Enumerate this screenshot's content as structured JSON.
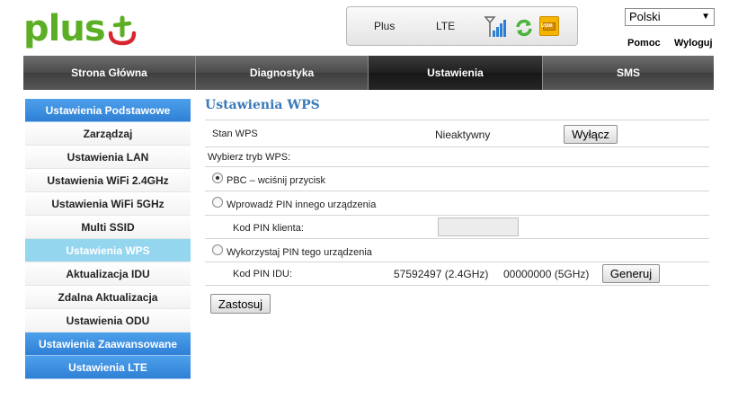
{
  "header": {
    "logo_text": "plus",
    "operator": "Plus",
    "network_type": "LTE",
    "sim_label": "USIM",
    "language_selected": "Polski",
    "help_label": "Pomoc",
    "logout_label": "Wyloguj"
  },
  "topnav": [
    {
      "label": "Strona Główna"
    },
    {
      "label": "Diagnostyka"
    },
    {
      "label": "Ustawienia"
    },
    {
      "label": "SMS"
    }
  ],
  "sidebar": {
    "items": [
      {
        "label": "Ustawienia Podstawowe"
      },
      {
        "label": "Zarządzaj"
      },
      {
        "label": "Ustawienia LAN"
      },
      {
        "label": "Ustawienia WiFi 2.4GHz"
      },
      {
        "label": "Ustawienia WiFi 5GHz"
      },
      {
        "label": "Multi SSID"
      },
      {
        "label": "Ustawienia WPS"
      },
      {
        "label": "Aktualizacja IDU"
      },
      {
        "label": "Zdalna Aktualizacja"
      },
      {
        "label": "Ustawienia ODU"
      },
      {
        "label": "Ustawienia Zaawansowane"
      },
      {
        "label": "Ustawienia LTE"
      }
    ]
  },
  "wps": {
    "title": "Ustawienia WPS",
    "status_label": "Stan WPS",
    "status_value": "Nieaktywny",
    "disable_button": "Wyłącz",
    "mode_label": "Wybierz tryb WPS:",
    "pbc_label": "PBC – wciśnij przycisk",
    "client_pin_option": "Wprowadź PIN innego urządzenia",
    "client_pin_label": "Kod PIN klienta:",
    "client_pin_value": "",
    "device_pin_option": "Wykorzystaj PIN tego urządzenia",
    "idu_pin_label": "Kod PIN IDU:",
    "idu_pin_24": "57592497 (2.4GHz)",
    "idu_pin_5": "00000000 (5GHz)",
    "generate_button": "Generuj",
    "apply_button": "Zastosuj"
  },
  "colors": {
    "brand_green": "#5cae24",
    "brand_red": "#d7262f",
    "nav_dark": "#4a4a4a",
    "sidebar_blue": "#2f80d6",
    "sidebar_selected": "#95d6ef",
    "title_blue": "#3a7ab8"
  }
}
